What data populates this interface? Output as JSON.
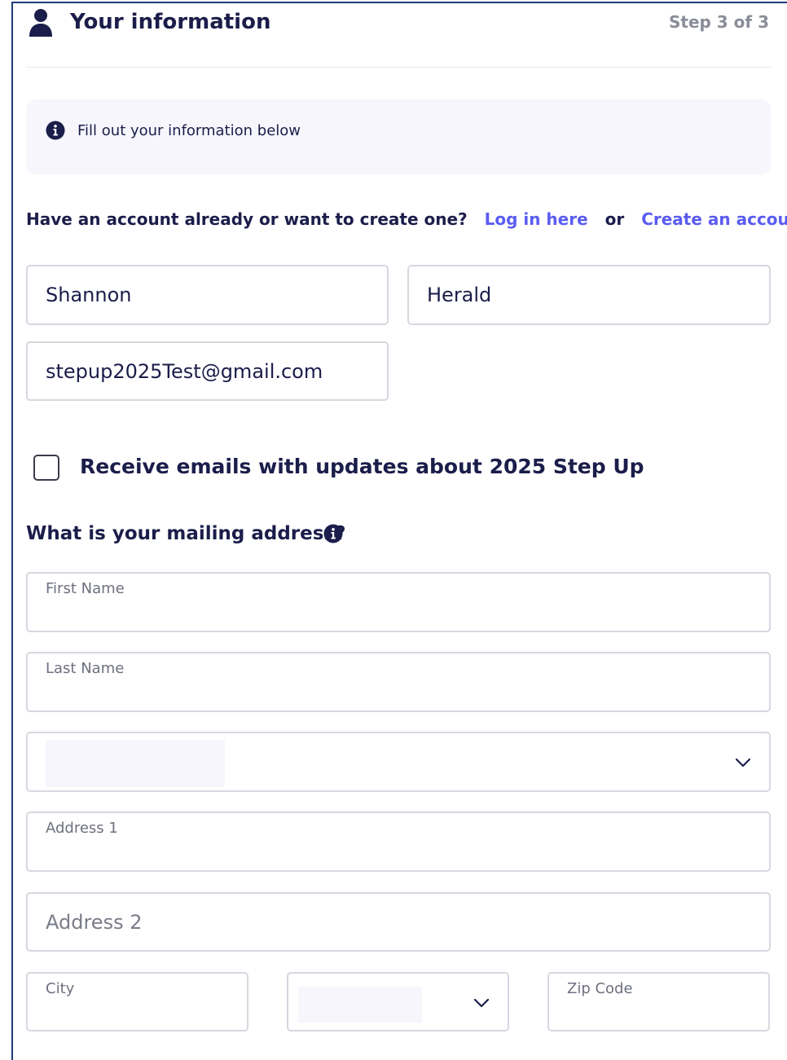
{
  "header": {
    "title": "Your information",
    "step": "Step 3 of 3",
    "icon": "person-icon"
  },
  "info_banner": {
    "icon": "info-icon",
    "text": "Fill out your information below"
  },
  "account": {
    "prompt": "Have an account already or want to create one?",
    "login_link": "Log in here",
    "or_text": "or",
    "create_link": "Create an account",
    "link_color": "#5a5cf0"
  },
  "contact": {
    "first_name": "Shannon",
    "last_name": "Herald",
    "email": "stepup2025Test@gmail.com"
  },
  "newsletter": {
    "checked": false,
    "label": "Receive emails with updates about 2025 Step Up"
  },
  "mailing": {
    "heading": "What is your mailing address?",
    "heading_icon": "info-icon",
    "first_name_label": "First Name",
    "last_name_label": "Last Name",
    "country_value": "",
    "address1_label": "Address 1",
    "address2_placeholder": "Address 2",
    "city_label": "City",
    "state_value": "",
    "zip_label": "Zip Code"
  },
  "colors": {
    "text": "#1b1d4a",
    "muted": "#8a8c99",
    "info_bg": "#f6f6fc",
    "border": "#d7d7e0"
  }
}
